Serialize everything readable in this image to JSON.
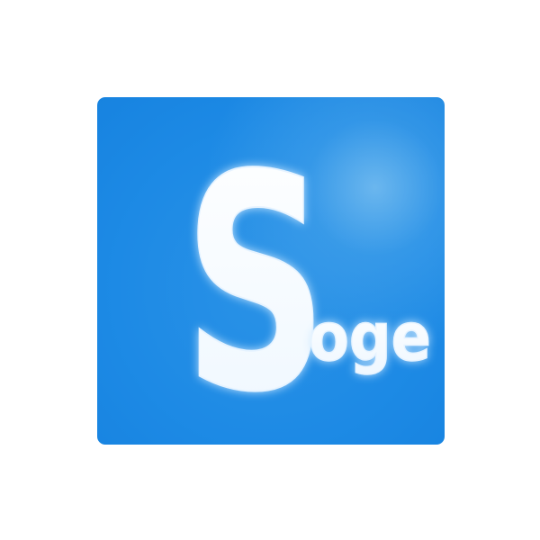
{
  "logo": {
    "initial": "S",
    "suffix": "oge",
    "colors": {
      "background": "#1d8ae5",
      "highlight": "#7cc0f2",
      "letter_fill": "#ffffff",
      "letter_glow": "#dff0ff"
    }
  }
}
